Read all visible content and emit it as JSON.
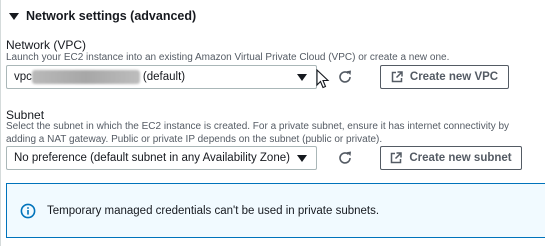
{
  "section": {
    "title": "Network settings (advanced)"
  },
  "network": {
    "label": "Network (VPC)",
    "description": "Launch your EC2 instance into an existing Amazon Virtual Private Cloud (VPC) or create a new one.",
    "selected_prefix": "vpc",
    "selected_suffix": "(default)",
    "create_button": "Create new VPC"
  },
  "subnet": {
    "label": "Subnet",
    "description": "Select the subnet in which the EC2 instance is created. For a private subnet, ensure it has internet connectivity by adding a NAT gateway. Public or private IP depends on the subnet (public or private).",
    "selected": "No preference (default subnet in any Availability Zone)",
    "create_button": "Create new subnet"
  },
  "alert": {
    "message": "Temporary managed credentials can't be used in private subnets."
  },
  "icons": {
    "section_toggle": "caret-down-icon",
    "refresh": "refresh-icon",
    "external_link": "external-link-icon",
    "info": "info-icon",
    "pointer": "mouse-cursor-icon"
  },
  "colors": {
    "info_border": "#0073bb",
    "info_background": "#f1faff",
    "secondary_text": "#545b64"
  }
}
